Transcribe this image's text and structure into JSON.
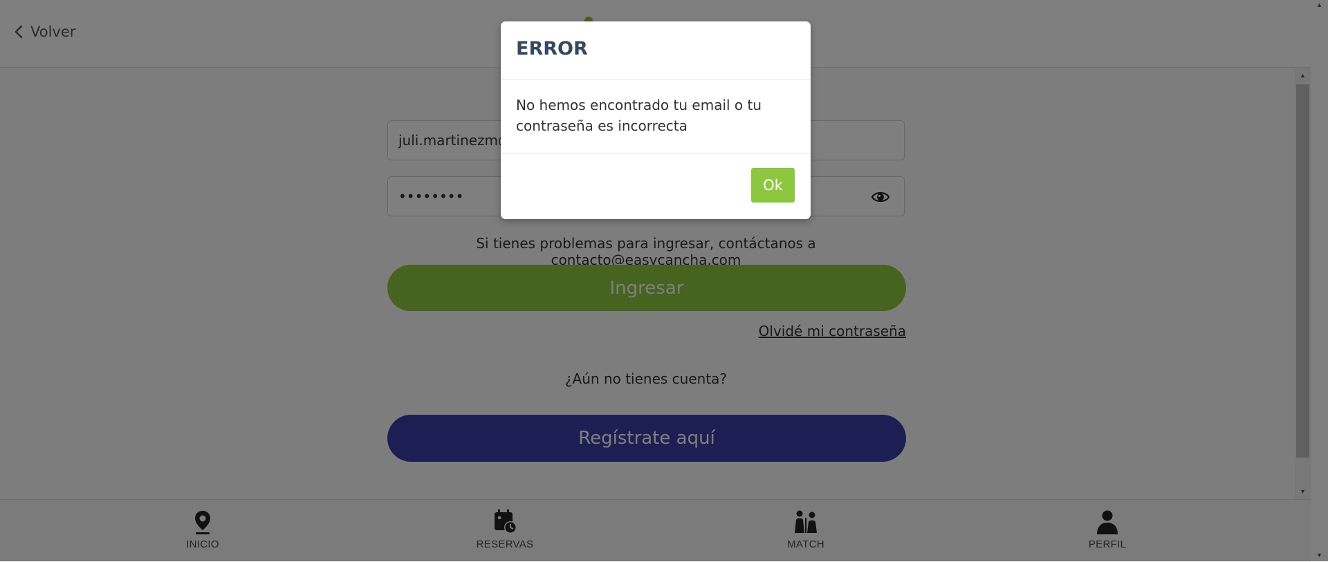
{
  "header": {
    "back_label": "Volver"
  },
  "login_form": {
    "email_value": "juli.martinezm@",
    "password_value": "••••••••",
    "help_text": "Si tienes problemas para ingresar, contáctanos a contacto@easycancha.com",
    "login_button_label": "Ingresar",
    "forgot_password_link": "Olvidé mi contraseña",
    "no_account_text": "¿Aún no tienes cuenta?",
    "register_button_label": "Regístrate aquí"
  },
  "bottom_nav": {
    "items": [
      {
        "label": "INICIO",
        "icon": "location-pin-icon"
      },
      {
        "label": "RESERVAS",
        "icon": "calendar-clock-icon"
      },
      {
        "label": "MATCH",
        "icon": "players-icon"
      },
      {
        "label": "PERFIL",
        "icon": "user-icon"
      }
    ]
  },
  "modal": {
    "title": "ERROR",
    "message": "No hemos encontrado tu email o tu contraseña es incorrecta",
    "ok_label": "Ok"
  },
  "colors": {
    "brand_green": "#8dc63f",
    "brand_indigo": "#3a3fa8",
    "modal_title": "#34495e"
  }
}
